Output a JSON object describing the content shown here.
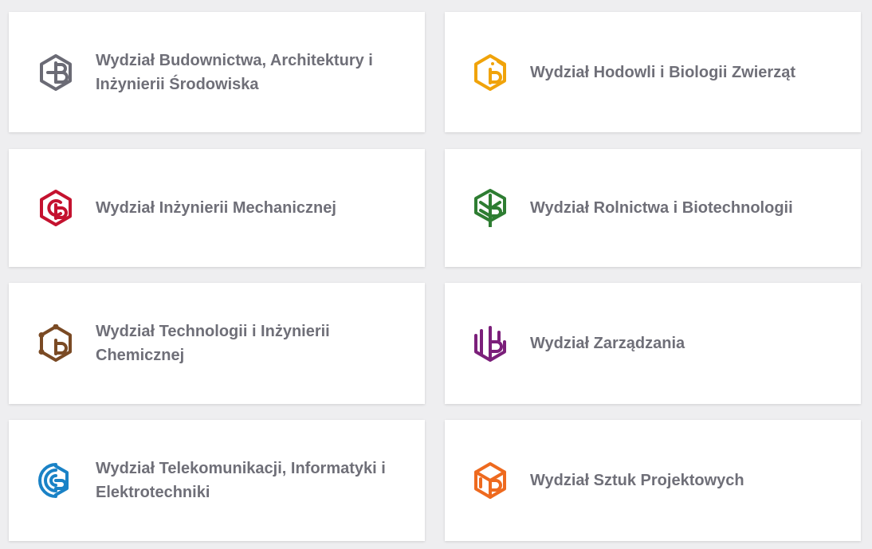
{
  "faculties": [
    {
      "label": "Wydział Budownictwa, Architektury i Inżynierii Środowiska",
      "icon": "faculty-civil-architecture-logo-icon",
      "color": "#6b6b75"
    },
    {
      "label": "Wydział Hodowli i Biologii Zwierząt",
      "icon": "faculty-animal-breeding-logo-icon",
      "color": "#f0a30a"
    },
    {
      "label": "Wydział Inżynierii Mechanicznej",
      "icon": "faculty-mechanical-logo-icon",
      "color": "#c4122f"
    },
    {
      "label": "Wydział Rolnictwa i Biotechnologii",
      "icon": "faculty-agriculture-leaf-logo-icon",
      "color": "#2e7d32"
    },
    {
      "label": "Wydział Technologii i Inżynierii Chemicznej",
      "icon": "faculty-chemical-logo-icon",
      "color": "#7a4a24"
    },
    {
      "label": "Wydział Zarządzania",
      "icon": "faculty-management-logo-icon",
      "color": "#7b1f7a"
    },
    {
      "label": "Wydział Telekomunikacji, Informatyki i Elektrotechniki",
      "icon": "faculty-telecom-logo-icon",
      "color": "#1a82c6"
    },
    {
      "label": "Wydział Sztuk Projektowych",
      "icon": "faculty-design-arts-logo-icon",
      "color": "#ee6a1f"
    }
  ]
}
